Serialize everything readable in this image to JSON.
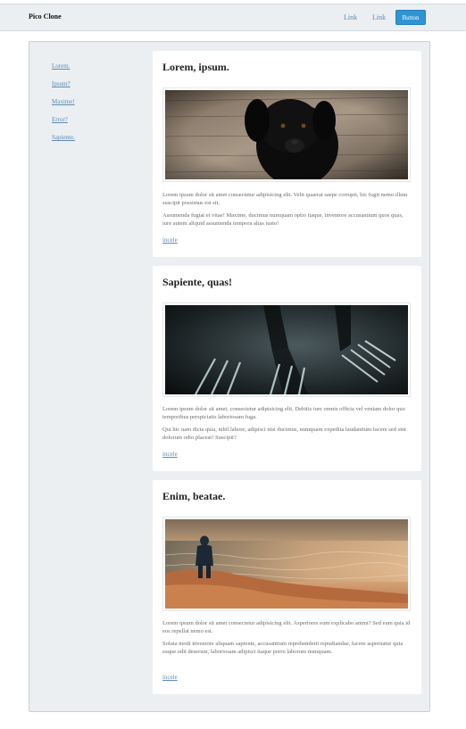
{
  "header": {
    "brand": "Pico Clone",
    "links": [
      "Link",
      "Link"
    ],
    "button_label": "Button"
  },
  "sidebar": {
    "items": [
      "Lorem.",
      "Ipsum?",
      "Maxime!",
      "Error?",
      "Sapiente."
    ]
  },
  "cards": [
    {
      "title": "Lorem, ipsum.",
      "image": "black-puppy-photo",
      "para1": "Lorem ipsum dolor sit amet consectetur adipisicing elit. Velit quaerat saepe corrupti, hic fugit nemo illum suscipit possimus est sit.",
      "para2": "Assumenda fugiat et vitae! Maxime, ducimus numquam optio itaque, inventore accusantium quos quas, iure autem aliquid assumenda tempora alias iusto!",
      "link": "incele"
    },
    {
      "title": "Sapiente, quas!",
      "image": "forks-photo",
      "para1": "Lorem ipsum dolor sit amet, consectetur adipisicing elit. Debitis iure omnis officia vel veniam dolor quo temporibus perspiciatis laboriosam fuga.",
      "para2": "Qui hic nam dicta quia, nihil labore, adipisci nisi ducimus, numquam expedita laudantium facere sed sint dolorum odio placeat! Suscipit?",
      "link": "incele"
    },
    {
      "title": "Enim, beatae.",
      "image": "person-at-sea-photo",
      "para1": "Lorem ipsum dolor sit amet consectetur adipisicing elit. Asperiores eum explicabo animi? Sed eum quia id eos repellat nemo est.",
      "para2": "Soluta modi inventore aliquam sapiente, accusantium reprehenderit repudiandae, facere aspernatur quia eaque odit deserunt, laboriosam adipisci itaque porro laborum numquam.",
      "link": "incele"
    }
  ]
}
